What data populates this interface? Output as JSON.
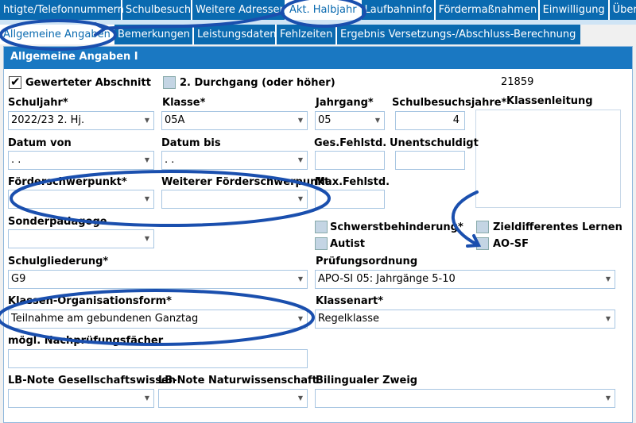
{
  "tabs_row1": [
    {
      "id": "t1",
      "label": "htigte/Telefonnummern"
    },
    {
      "id": "t2",
      "label": "Schulbesuch"
    },
    {
      "id": "t3",
      "label": "Weitere Adressen"
    },
    {
      "id": "t4",
      "label": "Akt. Halbjahr",
      "active": true
    },
    {
      "id": "t5",
      "label": "Laufbahninfo"
    },
    {
      "id": "t6",
      "label": "Fördermaßnahmen"
    },
    {
      "id": "t7",
      "label": "Einwilligung"
    },
    {
      "id": "t8",
      "label": "Über"
    }
  ],
  "tabs_row2": [
    {
      "id": "s1",
      "label": "Allgemeine Angaben",
      "active": true
    },
    {
      "id": "s2",
      "label": "Bemerkungen"
    },
    {
      "id": "s3",
      "label": "Leistungsdaten"
    },
    {
      "id": "s4",
      "label": "Fehlzeiten"
    },
    {
      "id": "s5",
      "label": "Ergebnis Versetzungs-/Abschluss-Berechnung"
    }
  ],
  "panel_title": "Allgemeine Angaben I",
  "gewerteter_abschnitt": {
    "label": "Gewerteter Abschnitt",
    "checked": true
  },
  "zweiter_durchgang": {
    "label": "2. Durchgang (oder höher)",
    "checked": false
  },
  "record_id": "21859",
  "labels": {
    "schuljahr": "Schuljahr*",
    "klasse": "Klasse*",
    "jahrgang": "Jahrgang*",
    "schulbesuchsjahre": "Schulbesuchsjahre*",
    "klassenleitung": "Klassenleitung",
    "datum_von": "Datum von",
    "datum_bis": "Datum bis",
    "ges_fehlstd": "Ges.Fehlstd.",
    "unentschuldigt": "Unentschuldigt",
    "foerderschwerpunkt": "Förderschwerpunkt*",
    "weiterer_foerderschwerpunkt": "Weiterer Förderschwerpunkt",
    "max_fehlstd": "Max.Fehlstd.",
    "sonderpaedagoge": "Sonderpädagoge",
    "schwerstbehinderung": "Schwerstbehinderung*",
    "zieldifferentes_lernen": "Zieldifferentes Lernen",
    "autist": "Autist",
    "ao_sf": "AO-SF",
    "schulgliederung": "Schulgliederung*",
    "pruefungsordnung": "Prüfungsordnung",
    "klassen_organisationsform": "Klassen-Organisationsform*",
    "klassenart": "Klassenart*",
    "nachpruefungsfaecher": "mögl. Nachprüfungsfächer",
    "lb_gesellschaft": "LB-Note Gesellschaftswissen",
    "lb_natur": "LB-Note Naturwissenschaft",
    "bilingualer_zweig": "Bilingualer Zweig"
  },
  "values": {
    "schuljahr": "2022/23 2. Hj.",
    "klasse": "05A",
    "jahrgang": "05",
    "schulbesuchsjahre": "4",
    "datum_von": " .  .",
    "datum_bis": " .  .",
    "schulgliederung": "G9",
    "pruefungsordnung": "APO-SI 05: Jahrgänge 5-10",
    "klassen_organisationsform": "Teilnahme am gebundenen Ganztag",
    "klassenart": "Regelklasse"
  },
  "annotation_color": "#1a4fae"
}
